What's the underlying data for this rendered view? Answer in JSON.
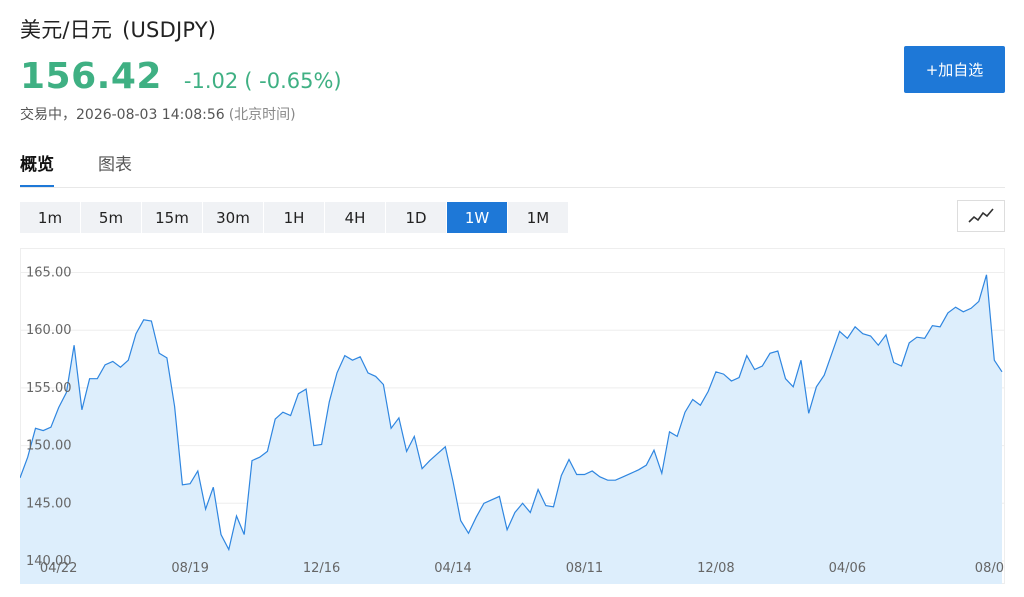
{
  "header": {
    "title": "美元/日元",
    "code": "(USDJPY)",
    "price": "156.42",
    "change": "-1.02",
    "change_pct": "( -0.65%)",
    "status": "交易中，2026-08-03 14:08:56",
    "timezone": "(北京时间)",
    "add_label": "+加自选",
    "price_color": "#3fb083"
  },
  "tabs": [
    {
      "label": "概览",
      "active": true
    },
    {
      "label": "图表",
      "active": false
    }
  ],
  "periods": [
    {
      "label": "1m",
      "active": false
    },
    {
      "label": "5m",
      "active": false
    },
    {
      "label": "15m",
      "active": false
    },
    {
      "label": "30m",
      "active": false
    },
    {
      "label": "1H",
      "active": false
    },
    {
      "label": "4H",
      "active": false
    },
    {
      "label": "1D",
      "active": false
    },
    {
      "label": "1W",
      "active": true
    },
    {
      "label": "1M",
      "active": false
    }
  ],
  "chart_type_icon": "line-chart-icon",
  "chart_data": {
    "type": "area",
    "ylim": [
      140,
      166
    ],
    "yticks": [
      "165.00",
      "160.00",
      "155.00",
      "150.00",
      "145.00",
      "140.00"
    ],
    "ytick_values": [
      165,
      160,
      155,
      150,
      145,
      140
    ],
    "x_tick_labels": [
      "04/22",
      "08/19",
      "12/16",
      "04/14",
      "08/11",
      "12/08",
      "04/06",
      "08/0"
    ],
    "x_tick_index": [
      5,
      22,
      39,
      56,
      73,
      90,
      107,
      124
    ],
    "line_color": "#2f86e0",
    "fill_color": "#ddeefc",
    "values": [
      147.2,
      149.0,
      151.5,
      151.3,
      151.6,
      153.3,
      154.6,
      158.7,
      153.1,
      155.8,
      155.8,
      157.0,
      157.3,
      156.8,
      157.4,
      159.7,
      160.9,
      160.8,
      158.0,
      157.6,
      153.4,
      146.6,
      146.7,
      147.8,
      144.5,
      146.4,
      142.3,
      141.0,
      143.9,
      142.3,
      148.7,
      149.0,
      149.5,
      152.3,
      152.9,
      152.6,
      154.5,
      154.9,
      150.0,
      150.1,
      153.8,
      156.3,
      157.8,
      157.4,
      157.7,
      156.3,
      156.0,
      155.3,
      151.5,
      152.4,
      149.5,
      150.8,
      148.0,
      148.7,
      149.3,
      149.9,
      146.9,
      143.5,
      142.4,
      143.8,
      145.0,
      145.3,
      145.6,
      142.7,
      144.2,
      145.0,
      144.2,
      146.2,
      144.8,
      144.7,
      147.4,
      148.8,
      147.5,
      147.5,
      147.8,
      147.3,
      147.0,
      147.0,
      147.3,
      147.6,
      147.9,
      148.3,
      149.6,
      147.6,
      151.2,
      150.8,
      152.9,
      154.0,
      153.5,
      154.7,
      156.4,
      156.2,
      155.6,
      155.9,
      157.8,
      156.6,
      156.9,
      158.0,
      158.2,
      155.8,
      155.1,
      157.4,
      152.8,
      155.1,
      156.1,
      158.0,
      159.9,
      159.3,
      160.3,
      159.7,
      159.5,
      158.7,
      159.6,
      157.2,
      156.9,
      158.9,
      159.4,
      159.3,
      160.4,
      160.3,
      161.5,
      162.0,
      161.6,
      161.9,
      162.5,
      164.8,
      157.4,
      156.4
    ]
  }
}
